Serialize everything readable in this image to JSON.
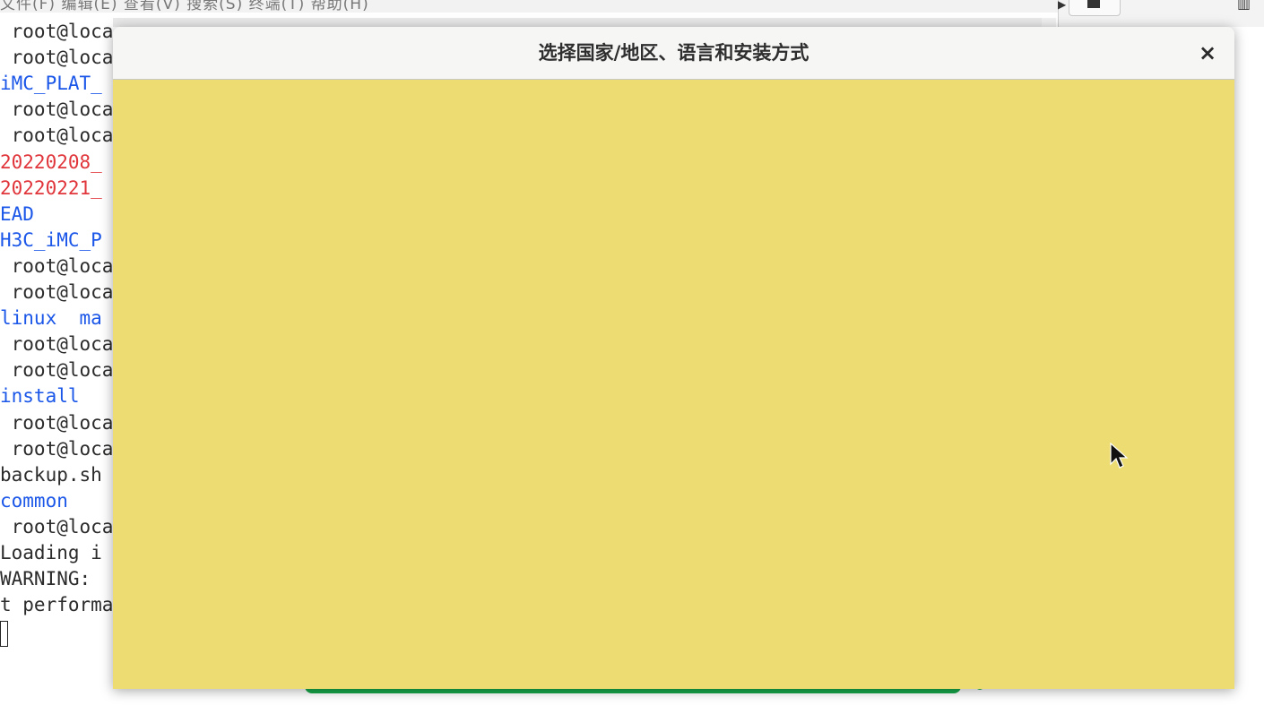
{
  "menubar": {
    "text": "文件(F)  编辑(E)  查看(V)  搜索(S)  终端(T)  帮助(H)"
  },
  "terminal": {
    "lines": [
      {
        "text": " root@loca",
        "color": "dark"
      },
      {
        "text": " root@loca",
        "color": "dark"
      },
      {
        "text": "iMC_PLAT_",
        "color": "blue"
      },
      {
        "text": " root@loca",
        "color": "dark"
      },
      {
        "text": " root@loca",
        "color": "dark"
      },
      {
        "text": "20220208_",
        "color": "red"
      },
      {
        "text": "20220221_",
        "color": "red"
      },
      {
        "text": "EAD",
        "color": "blue"
      },
      {
        "text": "H3C_iMC_P",
        "color": "blue"
      },
      {
        "text": " root@loca",
        "color": "dark"
      },
      {
        "text": " root@loca",
        "color": "dark"
      },
      {
        "text": "linux  ma",
        "color": "blue"
      },
      {
        "text": " root@loca",
        "color": "dark"
      },
      {
        "text": " root@loca",
        "color": "dark"
      },
      {
        "text": "install",
        "color": "blue"
      },
      {
        "text": " root@loca",
        "color": "dark"
      },
      {
        "text": " root@loca",
        "color": "dark"
      },
      {
        "text": "backup.sh",
        "color": "dark"
      },
      {
        "text": "common",
        "color": "blue"
      },
      {
        "text": " root@loca",
        "color": "dark"
      },
      {
        "text": "Loading i",
        "color": "dark"
      },
      {
        "text": "WARNING:",
        "color": "dark"
      },
      {
        "text": "t performa",
        "color": "dark"
      }
    ]
  },
  "dialog": {
    "title": "选择国家/地区、语言和安装方式",
    "close_label": "×",
    "body_color": "#ecdc72"
  },
  "colors": {
    "terminal_blue": "#1a56e8",
    "terminal_red": "#e0353a",
    "progress_green": "#17a84a"
  },
  "icons": {
    "close": "close-icon",
    "pointer": "mouse-pointer-icon"
  }
}
